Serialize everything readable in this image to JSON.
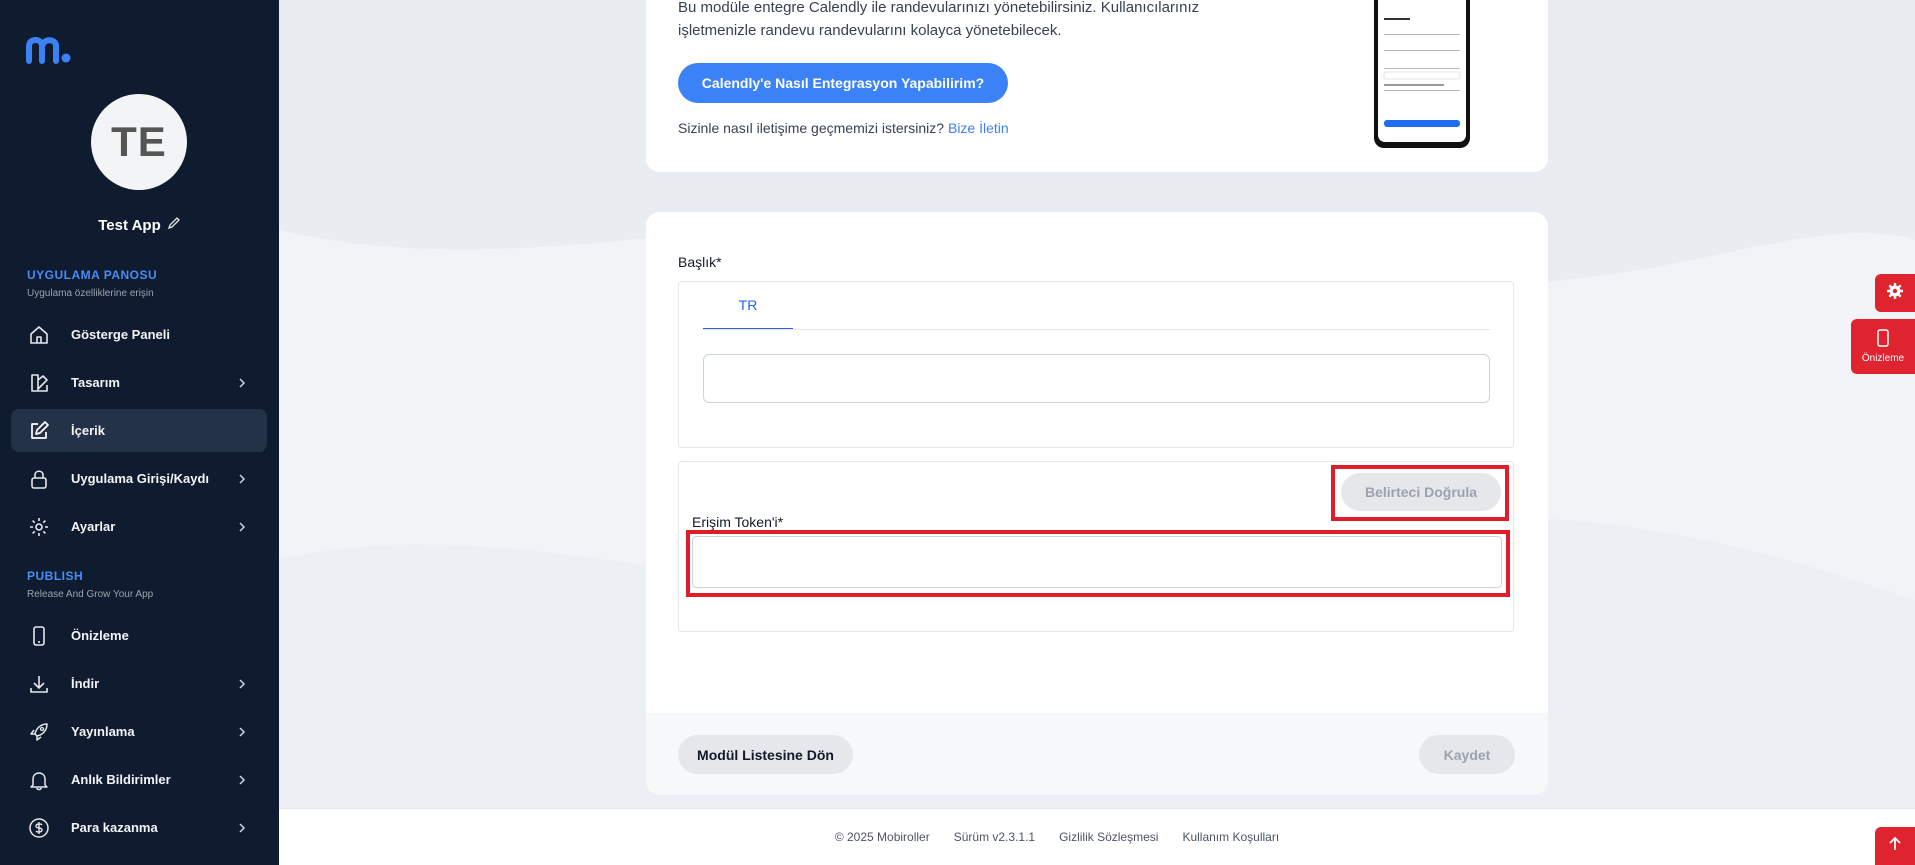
{
  "sidebar": {
    "avatar_initials": "TE",
    "app_name": "Test App",
    "section1": {
      "title": "UYGULAMA PANOSU",
      "subtitle": "Uygulama özelliklerine erişin"
    },
    "items1": [
      {
        "label": "Gösterge Paneli",
        "icon": "home-icon"
      },
      {
        "label": "Tasarım",
        "icon": "design-icon"
      },
      {
        "label": "İçerik",
        "icon": "edit-icon"
      },
      {
        "label": "Uygulama Girişi/Kaydı",
        "icon": "lock-icon"
      },
      {
        "label": "Ayarlar",
        "icon": "gear-icon"
      }
    ],
    "section2": {
      "title": "PUBLISH",
      "subtitle": "Release And Grow Your App"
    },
    "items2": [
      {
        "label": "Önizleme",
        "icon": "phone-icon"
      },
      {
        "label": "İndir",
        "icon": "download-icon"
      },
      {
        "label": "Yayınlama",
        "icon": "rocket-icon"
      },
      {
        "label": "Anlık Bildirimler",
        "icon": "bell-icon"
      },
      {
        "label": "Para kazanma",
        "icon": "dollar-icon"
      }
    ]
  },
  "intro": {
    "description": "Bu modüle entegre Calendly ile randevularınızı yönetebilirsiniz. Kullanıcılarınız işletmenizle randevu randevularını kolayca yönetebilecek.",
    "help_button": "Calendly'e Nasıl Entegrasyon Yapabilirim?",
    "contact_text": "Sizinle nasıl iletişime geçmemizi istersiniz?",
    "contact_link": "Bize İletin"
  },
  "form": {
    "title_label": "Başlık*",
    "lang_tab": "TR",
    "title_value": "",
    "verify_button": "Belirteci Doğrula",
    "token_label": "Erişim Token'i*",
    "token_value": "",
    "back_button": "Modül Listesine Dön",
    "save_button": "Kaydet"
  },
  "footer": {
    "copyright": "© 2025 Mobiroller",
    "version": "Sürüm v2.3.1.1",
    "privacy": "Gizlilik Sözleşmesi",
    "terms": "Kullanım Koşulları"
  },
  "floating": {
    "preview_label": "Önizleme"
  },
  "colors": {
    "sidebar_bg": "#0f1b2e",
    "accent": "#3b82f6",
    "danger": "#e0242f"
  }
}
